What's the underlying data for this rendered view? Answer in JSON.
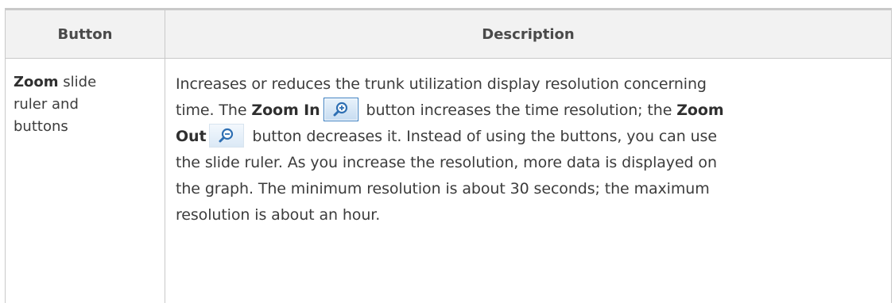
{
  "table": {
    "headers": {
      "button": "Button",
      "description": "Description"
    },
    "row": {
      "button_bold": "Zoom",
      "button_lines": [
        " slide",
        "ruler and",
        "buttons"
      ],
      "desc": {
        "l1": "Increases or reduces the trunk utilization display resolution concerning",
        "l2_a": "time. The ",
        "l2_zoom_in": "Zoom In",
        "l2_b": " button increases the time resolution; the ",
        "l2_zoom": "Zoom",
        "l3_out": "Out",
        "l3_b": " button decreases it. Instead of using the buttons, you can use",
        "l4": "the slide ruler. As you increase the resolution, more data is displayed on",
        "l5": "the graph. The minimum resolution is about 30 seconds; the maximum",
        "l6": "resolution is about an hour."
      },
      "icons": {
        "zoom_in": "zoom-in-icon",
        "zoom_out": "zoom-out-icon"
      }
    }
  },
  "colors": {
    "header_bg": "#f2f2f2",
    "border": "#c9c9c9",
    "icon_blue": "#2e6fb3"
  }
}
